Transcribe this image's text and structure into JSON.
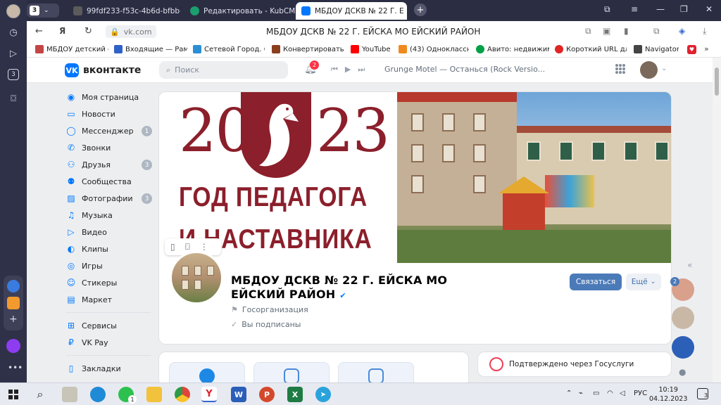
{
  "sidebar_left": {
    "icons": [
      "history-icon",
      "play-icon",
      "tab-count-icon",
      "camera-icon",
      "app-icon-1",
      "app-icon-2",
      "plus-icon",
      "alice-icon",
      "more-icon"
    ],
    "tabs_count": "3"
  },
  "browser": {
    "tabs": [
      {
        "title": "99fdf233-f53c-4b6d-bfbb-",
        "color": "#5b5b5b"
      },
      {
        "title": "Редактировать - KubCMS",
        "color": "#1c9e6e"
      },
      {
        "title": "МБДОУ ДСКВ № 22 Г. Е",
        "color": "#0077ff"
      }
    ],
    "tab_count": "3",
    "url": "vk.com",
    "page_title": "МБДОУ ДСКВ № 22 Г. ЕЙСКА МО ЕЙСКИЙ РАЙОН",
    "bookmarks": [
      {
        "label": "МБДОУ детский с",
        "color": "#c44545"
      },
      {
        "label": "Входящие — Рам",
        "color": "#3061c8"
      },
      {
        "label": "Сетевой Город. О",
        "color": "#2a8fd4"
      },
      {
        "label": "Конвертировать E",
        "color": "#8a3f1f"
      },
      {
        "label": "YouTube",
        "color": "#ff0000"
      },
      {
        "label": "(43) Однокласснс",
        "color": "#f08a1c"
      },
      {
        "label": "Авито: недвижим",
        "color": "#00a046"
      },
      {
        "label": "Короткий URL для",
        "color": "#e02525"
      },
      {
        "label": "Navigator",
        "color": "#444444"
      }
    ]
  },
  "vk": {
    "logo": "вконтакте",
    "search_placeholder": "Поиск",
    "notifications": "2",
    "song": "Grunge Motel — Останься (Rock Versio...",
    "menu": [
      {
        "label": "Моя страница",
        "icon": "user-circle-icon",
        "count": ""
      },
      {
        "label": "Новости",
        "icon": "news-icon",
        "count": ""
      },
      {
        "label": "Мессенджер",
        "icon": "messenger-icon",
        "count": "1"
      },
      {
        "label": "Звонки",
        "icon": "phone-icon",
        "count": ""
      },
      {
        "label": "Друзья",
        "icon": "friends-icon",
        "count": "3"
      },
      {
        "label": "Сообщества",
        "icon": "communities-icon",
        "count": ""
      },
      {
        "label": "Фотографии",
        "icon": "photos-icon",
        "count": "3"
      },
      {
        "label": "Музыка",
        "icon": "music-icon",
        "count": ""
      },
      {
        "label": "Видео",
        "icon": "video-icon",
        "count": ""
      },
      {
        "label": "Клипы",
        "icon": "clips-icon",
        "count": ""
      },
      {
        "label": "Игры",
        "icon": "games-icon",
        "count": ""
      },
      {
        "label": "Стикеры",
        "icon": "stickers-icon",
        "count": ""
      },
      {
        "label": "Маркет",
        "icon": "market-icon",
        "count": ""
      }
    ],
    "menu2": [
      {
        "label": "Сервисы",
        "icon": "services-icon"
      },
      {
        "label": "VK Pay",
        "icon": "vkpay-icon"
      }
    ],
    "menu3": [
      {
        "label": "Закладки",
        "icon": "bookmarks-icon"
      }
    ],
    "cover": {
      "year_left": "20",
      "year_right": "23",
      "line1": "ГОД ПЕДАГОГА",
      "line2": "И НАСТАВНИКА"
    },
    "group": {
      "name": "МБДОУ ДСКВ № 22 Г. ЕЙСКА МО ЕЙСКИЙ РАЙОН",
      "type": "Госорганизация",
      "subscribed": "Вы подписаны",
      "btn_contact": "Связаться",
      "btn_more": "Ещё"
    },
    "gosuslugi": "Подтверждено через Госуслуги",
    "right_badge": "2"
  },
  "taskbar": {
    "lang": "РУС",
    "time": "10:19",
    "date": "04.12.2023",
    "whatsapp_badge": "1",
    "notif_badge": "3"
  }
}
